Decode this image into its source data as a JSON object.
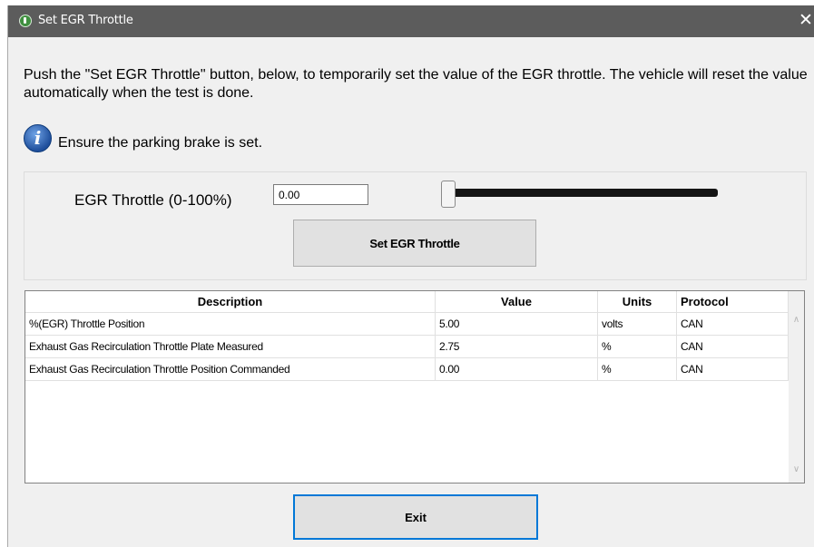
{
  "window": {
    "title": "Set EGR Throttle",
    "close_label": "✕"
  },
  "instructions": "Push the \"Set EGR Throttle\" button, below, to temporarily set the value of the EGR throttle.  The vehicle will reset the value automatically when the test is done.",
  "notice": {
    "icon": "info-icon",
    "glyph": "i",
    "text": "Ensure the parking brake is set."
  },
  "throttle": {
    "label": "EGR Throttle (0-100%)",
    "value": "0.00",
    "slider_level": 0,
    "set_button_label": "Set EGR Throttle"
  },
  "table": {
    "columns": [
      "Description",
      "Value",
      "Units",
      "Protocol"
    ],
    "rows": [
      {
        "description": "%(EGR) Throttle Position",
        "value": "5.00",
        "units": "volts",
        "protocol": "CAN"
      },
      {
        "description": "Exhaust Gas Recirculation Throttle Plate Measured",
        "value": "2.75",
        "units": "%",
        "protocol": "CAN"
      },
      {
        "description": "Exhaust Gas Recirculation Throttle Position Commanded",
        "value": "0.00",
        "units": "%",
        "protocol": "CAN"
      }
    ],
    "scroll_up_glyph": "∧",
    "scroll_down_glyph": "∨"
  },
  "exit_button_label": "Exit",
  "colors": {
    "titlebar": "#5c5c5c",
    "window_bg": "#f0f0f0",
    "focus_border": "#0078d7",
    "slider_track": "#141414"
  }
}
